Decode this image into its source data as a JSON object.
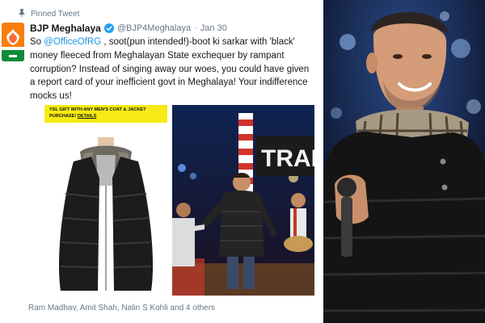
{
  "tweet": {
    "pinned_label": "Pinned Tweet",
    "display_name": "BJP Meghalaya",
    "handle": "@BJP4Meghalaya",
    "dot": "·",
    "date": "Jan 30",
    "text_part1": "So ",
    "mention": "@OfficeOfRG",
    "text_part2": " , soot(pun intended!)-boot ki sarkar with 'black' money fleeced from Meghalayan State exchequer by rampant corruption? Instead of singing away our woes, you could have given a report card of your inefficient govt in Meghalaya! Your indifference mocks us!",
    "tagged": "Ram Madhav, Amit Shah, Nalin S Kohli and 4 others"
  },
  "ad": {
    "banner_line1": "YSL GIFT WITH ANY MEN'S COAT & JACKET",
    "banner_line2": "PURCHASE! ",
    "banner_link": "DETAILS"
  },
  "stage": {
    "sign_text": "TRAD"
  },
  "colors": {
    "link": "#1b95e0",
    "secondary_text": "#657786",
    "banner_yellow": "#f7ea16",
    "bjp_orange": "#f97d09"
  }
}
